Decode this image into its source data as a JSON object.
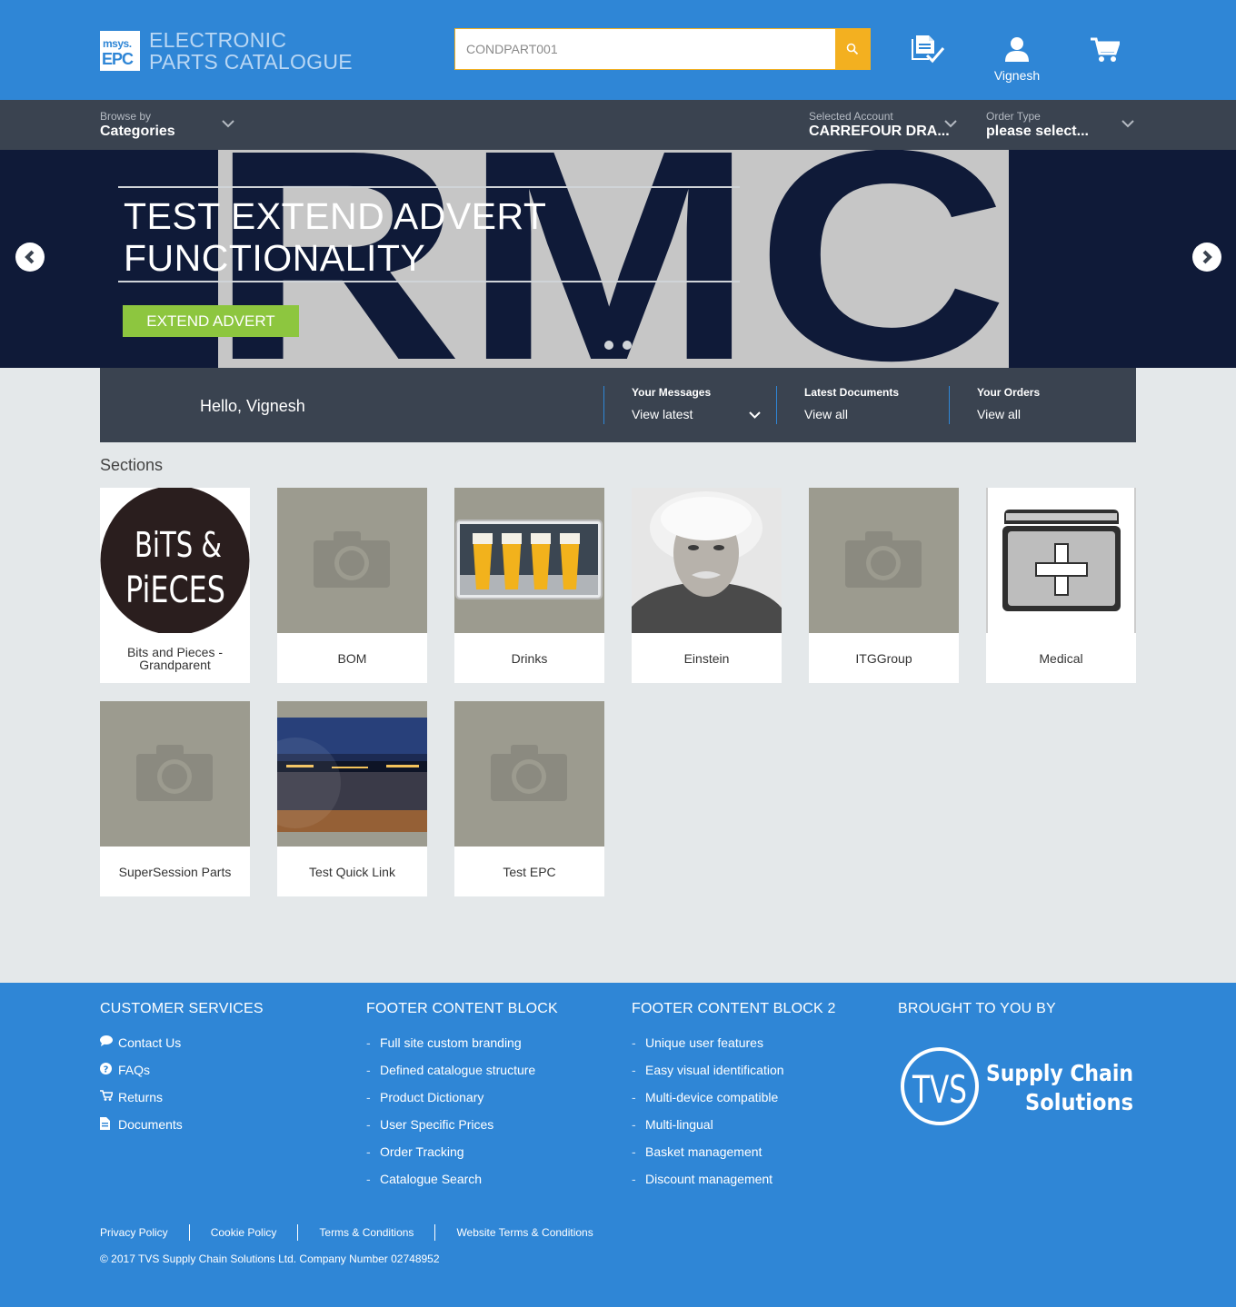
{
  "header": {
    "logo_top": "msys.",
    "logo_bottom": "EPC",
    "logo_line1": "ELECTRONIC",
    "logo_line2": "PARTS CATALOGUE",
    "search_value": "CONDPART001",
    "user_name": "Vignesh"
  },
  "nav": {
    "browse_small": "Browse by",
    "browse_big": "Categories",
    "account_small": "Selected Account",
    "account_big": "CARREFOUR DRA...",
    "order_small": "Order Type",
    "order_big": "please select..."
  },
  "banner": {
    "title_line1": "TEST EXTEND ADVERT",
    "title_line2": "FUNCTIONALITY",
    "button": "EXTEND ADVERT",
    "art_text": "RMC"
  },
  "welcome": {
    "hello": "Hello, Vignesh",
    "messages_title": "Your Messages",
    "messages_value": "View latest",
    "documents_title": "Latest Documents",
    "documents_value": "View all",
    "orders_title": "Your Orders",
    "orders_value": "View all"
  },
  "sections": {
    "title": "Sections",
    "items": [
      {
        "label": "Bits and Pieces - Grandparent",
        "logo_line1": "BiTS &",
        "logo_line2": "PiECES"
      },
      {
        "label": "BOM"
      },
      {
        "label": "Drinks"
      },
      {
        "label": "Einstein"
      },
      {
        "label": "ITGGroup"
      },
      {
        "label": "Medical"
      },
      {
        "label": "SuperSession Parts"
      },
      {
        "label": "Test Quick Link"
      },
      {
        "label": "Test EPC"
      }
    ]
  },
  "footer": {
    "col1": {
      "title": "CUSTOMER SERVICES",
      "items": [
        {
          "label": "Contact Us",
          "icon": "comment-icon"
        },
        {
          "label": "FAQs",
          "icon": "question-circle-icon"
        },
        {
          "label": "Returns",
          "icon": "cart-return-icon"
        },
        {
          "label": "Documents",
          "icon": "document-icon"
        }
      ]
    },
    "col2": {
      "title": "FOOTER CONTENT BLOCK",
      "items": [
        "Full site custom branding",
        "Defined catalogue structure",
        "Product Dictionary",
        "User Specific Prices",
        "Order Tracking",
        "Catalogue Search"
      ]
    },
    "col3": {
      "title": "FOOTER CONTENT BLOCK 2",
      "items": [
        "Unique user features",
        "Easy visual identification",
        "Multi-device compatible",
        "Multi-lingual",
        "Basket management",
        "Discount management"
      ]
    },
    "col4": {
      "title": "BROUGHT TO YOU BY",
      "brand_mark": "TVS",
      "brand_line1": "Supply Chain",
      "brand_line2": "Solutions"
    },
    "links": [
      "Privacy Policy",
      "Cookie Policy",
      "Terms & Conditions",
      "Website Terms & Conditions"
    ],
    "copyright": "© 2017 TVS Supply Chain Solutions Ltd. Company Number 02748952",
    "bullet": "-"
  },
  "colors": {
    "primary_blue": "#2f86d6",
    "dark_bar": "#3a4350",
    "search_accent": "#f3b020",
    "button_green": "#8dc63f",
    "page_bg": "#e4e8ea"
  }
}
